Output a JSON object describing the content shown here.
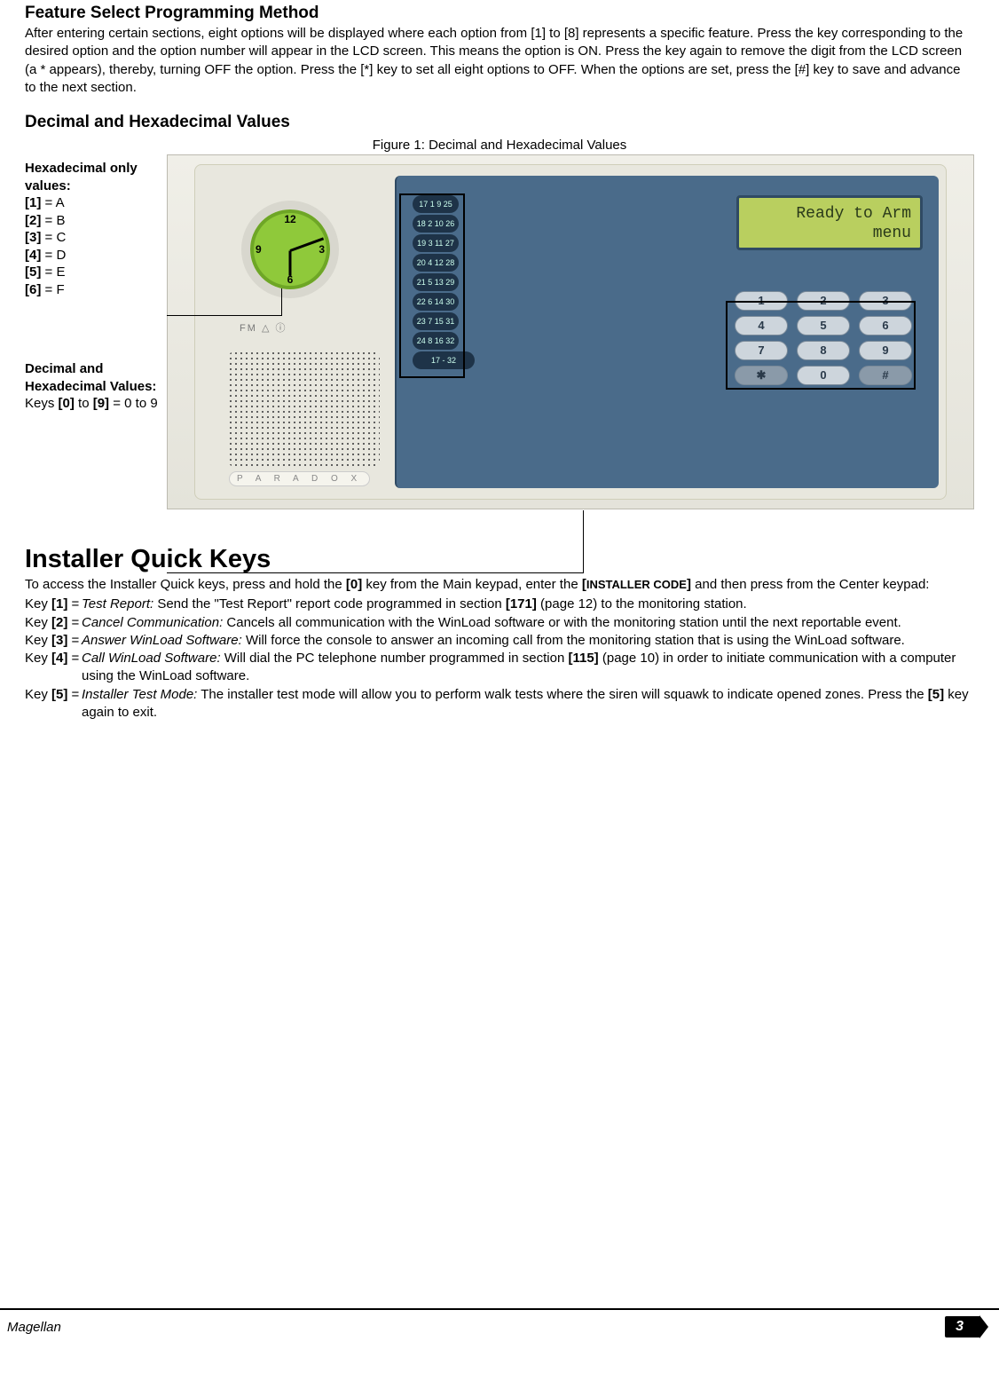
{
  "section1": {
    "title": "Feature Select Programming Method",
    "body": "After entering certain sections, eight options will be displayed where each option from [1] to [8] represents a specific feature. Press the key corresponding to the desired option and the option number will appear in the LCD screen. This means the option is ON. Press the key again to remove the digit from the LCD screen (a * appears), thereby, turning OFF the option. Press the [*] key to set all eight options to OFF. When the options are set, press the [#] key to save and advance to the next section."
  },
  "section2": {
    "title": "Decimal and Hexadecimal Values",
    "figcaption": "Figure 1: Decimal and Hexadecimal Values"
  },
  "leftlabels": {
    "hex_title": "Hexadecimal only values:",
    "hex_lines": [
      "[1] = A",
      "[2] = B",
      "[3] = C",
      "[4] = D",
      "[5] = E",
      "[6] = F"
    ],
    "dec_title": "Decimal and Hexadecimal Values:",
    "dec_body": "Keys [0] to [9] = 0 to 9"
  },
  "device": {
    "lcd_line1": "Ready to Arm",
    "lcd_line2": "menu",
    "zone_buttons": [
      "17 1  9 25",
      "18 2 10 26",
      "19 3 11 27",
      "20 4 12 28",
      "21 5 13 29",
      "22 6 14 30",
      "23 7 15 31",
      "24 8 16 32",
      "17 - 32"
    ],
    "keypad": [
      "1",
      "2",
      "3",
      "4",
      "5",
      "6",
      "7",
      "8",
      "9",
      "✱",
      "0",
      "#"
    ],
    "fm": "FM  △  ⓘ",
    "logo": "P A R A D O X",
    "clock": {
      "twelve": "12",
      "three": "3",
      "six": "6",
      "nine": "9"
    }
  },
  "installer": {
    "title": "Installer Quick Keys",
    "intro_pre": "To access the Installer Quick keys, press and hold the ",
    "intro_key0": "[0]",
    "intro_mid": " key from the Main keypad, enter the ",
    "intro_code": "[INSTALLER CODE]",
    "intro_post": " and then press from the Center keypad:",
    "keys": [
      {
        "k": "Key [1] =",
        "name": "Test Report:",
        "desc": " Send the \"Test Report\" report code programmed in section [171] (page 12) to the monitoring station."
      },
      {
        "k": "Key [2] =",
        "name": "Cancel Communication:",
        "desc": " Cancels all communication with the WinLoad software or with the monitoring station until the next reportable event."
      },
      {
        "k": "Key [3] =",
        "name": "Answer WinLoad Software:",
        "desc": " Will force the console to answer an incoming call from the monitoring station that is using the WinLoad software."
      },
      {
        "k": "Key [4] =",
        "name": "Call WinLoad Software:",
        "desc": " Will dial the PC telephone number programmed in section [115] (page 10) in order to initiate communication with a computer using the WinLoad software."
      },
      {
        "k": "Key [5] =",
        "name": "Installer Test Mode:",
        "desc": " The installer test mode will allow you to perform walk tests where the siren will squawk to indicate opened zones. Press the [5] key again to exit."
      }
    ]
  },
  "footer": {
    "product": "Magellan",
    "page": "3"
  }
}
